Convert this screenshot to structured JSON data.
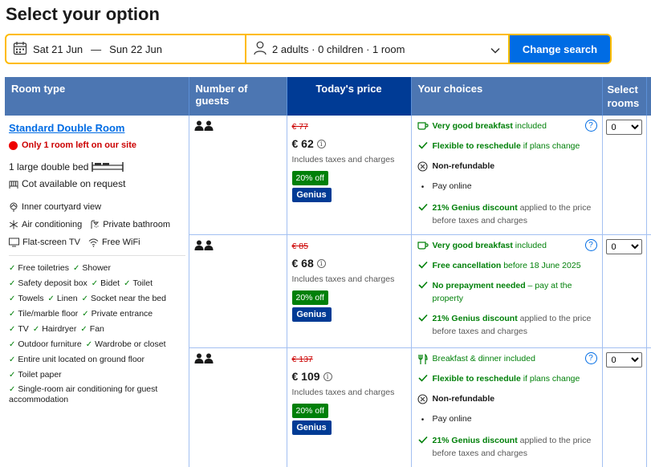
{
  "title": "Select your option",
  "search": {
    "checkin": "Sat 21 Jun",
    "separator": "—",
    "checkout": "Sun 22 Jun",
    "guests": "2 adults · 0 children · 1 room",
    "button": "Change search",
    "accent": "#febb02",
    "button_color": "#006ce4"
  },
  "table": {
    "headers": {
      "room_type": "Room type",
      "guests": "Number of guests",
      "price": "Today's price",
      "choices": "Your choices",
      "select": "Select rooms"
    }
  },
  "room": {
    "name": "Standard Double Room",
    "scarcity": "Only 1 room left on our site",
    "bed": "1 large double bed",
    "cot": "Cot available on request",
    "features": [
      "Inner courtyard view",
      "Air conditioning",
      "Private bathroom",
      "Flat-screen TV",
      "Free WiFi"
    ],
    "amenities": [
      "Free toiletries",
      "Shower",
      "Safety deposit box",
      "Bidet",
      "Toilet",
      "Towels",
      "Linen",
      "Socket near the bed",
      "Tile/marble floor",
      "Private entrance",
      "TV",
      "Hairdryer",
      "Fan",
      "Outdoor furniture",
      "Wardrobe or closet",
      "Entire unit located on ground floor",
      "Toilet paper",
      "Single-room air conditioning for guest accommodation"
    ]
  },
  "offers": [
    {
      "old_price": "€ 77",
      "price": "€ 62",
      "tax_note": "Includes taxes and charges",
      "discount_badge": "20% off",
      "genius_badge": "Genius",
      "choices": [
        {
          "icon": "coffee-icon",
          "bold": "Very good breakfast",
          "rest": " included",
          "style": "green"
        },
        {
          "icon": "check-icon",
          "bold": "Flexible to reschedule",
          "rest": " if plans change",
          "style": "green"
        },
        {
          "icon": "nonrefund-icon",
          "bold": "Non-refundable",
          "rest": "",
          "style": "dark"
        },
        {
          "icon": "bullet-icon",
          "bold": "",
          "rest": "Pay online",
          "style": "dark"
        },
        {
          "icon": "check-icon",
          "bold": "21% Genius discount",
          "rest": " applied to the price before taxes and charges",
          "style": "green"
        }
      ],
      "select_value": "0"
    },
    {
      "old_price": "€ 85",
      "price": "€ 68",
      "tax_note": "Includes taxes and charges",
      "discount_badge": "20% off",
      "genius_badge": "Genius",
      "choices": [
        {
          "icon": "coffee-icon",
          "bold": "Very good breakfast",
          "rest": " included",
          "style": "green"
        },
        {
          "icon": "check-icon",
          "bold": "Free cancellation",
          "rest": " before 18 June 2025",
          "style": "green"
        },
        {
          "icon": "check-icon",
          "bold": "No prepayment needed",
          "rest": " – pay at the property",
          "style": "green"
        },
        {
          "icon": "check-icon",
          "bold": "21% Genius discount",
          "rest": " applied to the price before taxes and charges",
          "style": "green"
        }
      ],
      "select_value": "0"
    },
    {
      "old_price": "€ 137",
      "price": "€ 109",
      "tax_note": "Includes taxes and charges",
      "discount_badge": "20% off",
      "genius_badge": "Genius",
      "choices": [
        {
          "icon": "fork-knife-icon",
          "bold": "",
          "rest": "Breakfast & dinner included",
          "style": "green"
        },
        {
          "icon": "check-icon",
          "bold": "Flexible to reschedule",
          "rest": " if plans change",
          "style": "green"
        },
        {
          "icon": "nonrefund-icon",
          "bold": "Non-refundable",
          "rest": "",
          "style": "dark"
        },
        {
          "icon": "bullet-icon",
          "bold": "",
          "rest": "Pay online",
          "style": "dark"
        },
        {
          "icon": "check-icon",
          "bold": "21% Genius discount",
          "rest": " applied to the price before taxes and charges",
          "style": "green"
        }
      ],
      "select_value": "0"
    }
  ]
}
